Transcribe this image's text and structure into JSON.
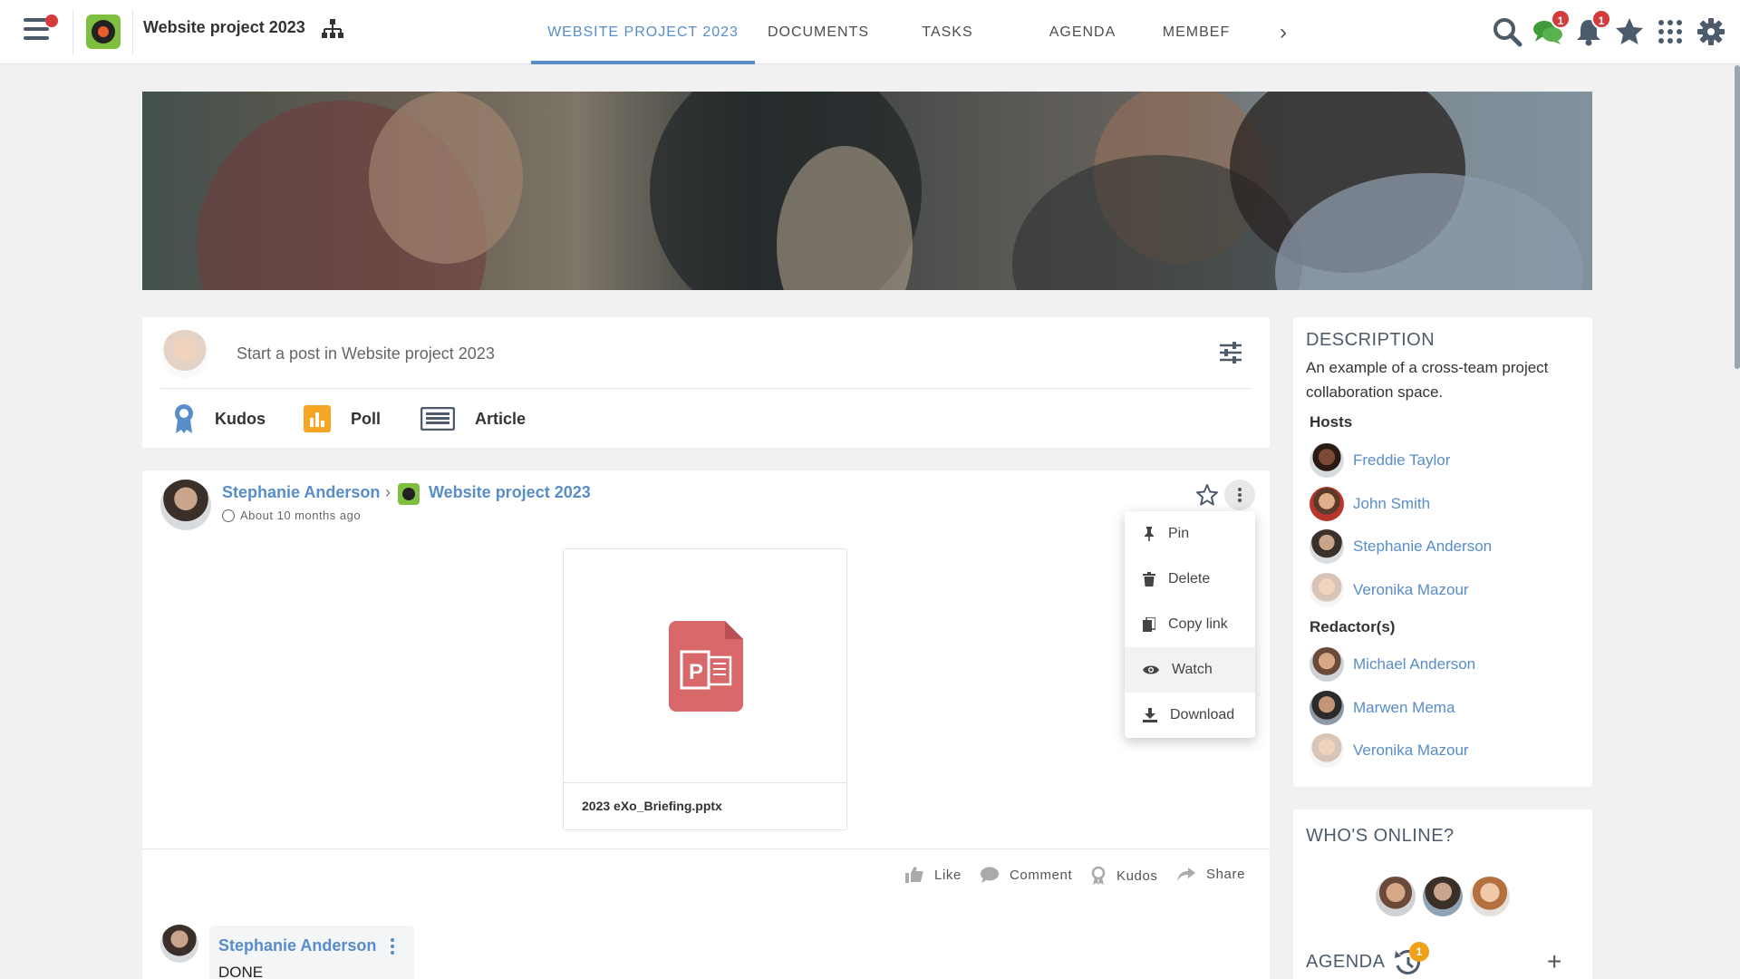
{
  "topbar": {
    "space_title": "Website project 2023",
    "tabs": [
      {
        "label": "WEBSITE PROJECT 2023",
        "active": true
      },
      {
        "label": "DOCUMENTS"
      },
      {
        "label": "TASKS"
      },
      {
        "label": "AGENDA"
      },
      {
        "label": "MEMBEF"
      }
    ],
    "chats_badge": "1",
    "notifications_badge": "1",
    "icons": [
      "hamburger-menu-icon",
      "space-tree-icon",
      "chevron-right-icon",
      "search-icon",
      "chat-icon",
      "bell-icon",
      "star-icon",
      "apps-grid-icon",
      "gear-icon"
    ],
    "accent_color": "#578dc9",
    "badge_color": "#d63b3b"
  },
  "composer": {
    "placeholder": "Start a post in Website project 2023",
    "actions": [
      {
        "label": "Kudos",
        "icon": "kudos-ribbon-icon"
      },
      {
        "label": "Poll",
        "icon": "poll-icon"
      },
      {
        "label": "Article",
        "icon": "article-icon"
      }
    ]
  },
  "post": {
    "author": "Stephanie Anderson",
    "space": "Website project 2023",
    "time": "About 10 months ago",
    "attachment": {
      "file_name": "2023 eXo_Briefing.pptx",
      "icon": "powerpoint-file-icon",
      "icon_color": "#d9686a"
    },
    "reactions": [
      {
        "label": "Like",
        "icon": "thumbs-up-icon"
      },
      {
        "label": "Comment",
        "icon": "comment-icon"
      },
      {
        "label": "Kudos",
        "icon": "kudos-icon"
      },
      {
        "label": "Share",
        "icon": "share-icon"
      }
    ],
    "menu": [
      {
        "label": "Pin",
        "icon": "pin-icon"
      },
      {
        "label": "Delete",
        "icon": "trash-icon"
      },
      {
        "label": "Copy link",
        "icon": "copy-icon"
      },
      {
        "label": "Watch",
        "icon": "eye-icon"
      },
      {
        "label": "Download",
        "icon": "download-icon"
      }
    ],
    "comment": {
      "author": "Stephanie Anderson",
      "text": "DONE"
    }
  },
  "description": {
    "heading": "DESCRIPTION",
    "text": "An example of a cross-team project collaboration space.",
    "hosts_label": "Hosts",
    "hosts": [
      "Freddie Taylor",
      "John Smith",
      "Stephanie Anderson",
      "Veronika Mazour"
    ],
    "redactors_label": "Redactor(s)",
    "redactors": [
      "Michael Anderson",
      "Marwen Mema",
      "Veronika Mazour"
    ]
  },
  "online": {
    "heading": "WHO'S ONLINE?",
    "agenda_label": "AGENDA",
    "agenda_badge": "1"
  }
}
